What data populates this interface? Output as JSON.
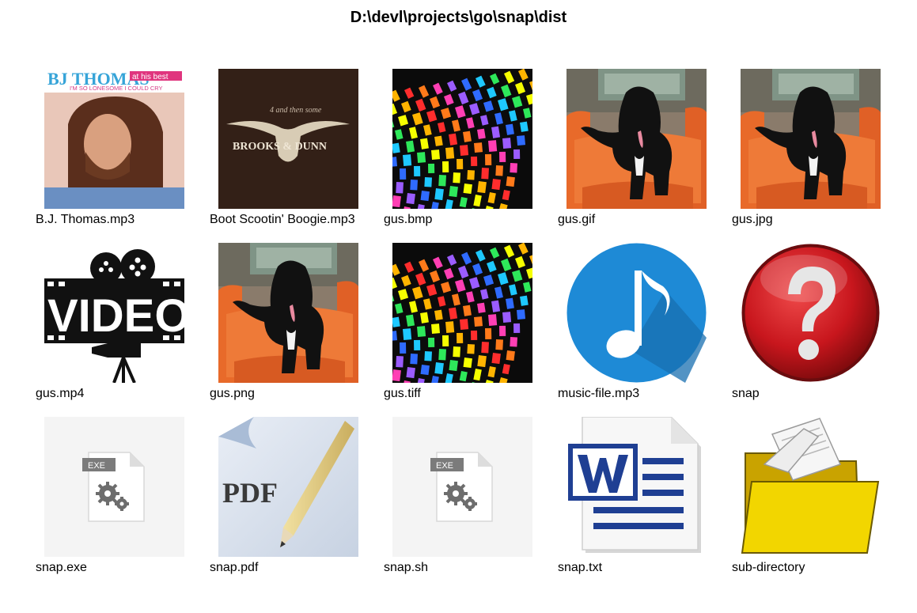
{
  "window": {
    "title": "D:\\devl\\projects\\go\\snap\\dist"
  },
  "colors": {
    "folder_yellow": "#f2d600",
    "word_blue": "#1f3f93",
    "music_blue": "#1e8ad6",
    "help_red": "#c8161d",
    "exe_gray": "#7b7b7b",
    "chair_orange": "#e86a2a"
  },
  "album_art": {
    "bj_name": "BJ THOMAS",
    "bj_badge": "at his best",
    "bj_subtitle": "I'M SO LONESOME I COULD CRY",
    "bd_text": "BROOKS & DUNN",
    "bd_script": "4 and then some",
    "video_text": "VIDEO",
    "pdf_text": "PDF",
    "exe_badge": "EXE"
  },
  "files": [
    {
      "name": "B.J. Thomas.mp3",
      "icon": "album-art-bj-thomas"
    },
    {
      "name": "Boot Scootin' Boogie.mp3",
      "icon": "album-art-brooks-dunn"
    },
    {
      "name": "gus.bmp",
      "icon": "mosaic-image"
    },
    {
      "name": "gus.gif",
      "icon": "dog-photo"
    },
    {
      "name": "gus.jpg",
      "icon": "dog-photo"
    },
    {
      "name": "gus.mp4",
      "icon": "video-camera-icon"
    },
    {
      "name": "gus.png",
      "icon": "dog-photo"
    },
    {
      "name": "gus.tiff",
      "icon": "mosaic-image"
    },
    {
      "name": "music-file.mp3",
      "icon": "music-note-icon"
    },
    {
      "name": "snap",
      "icon": "question-mark-icon"
    },
    {
      "name": "snap.exe",
      "icon": "exe-file-icon"
    },
    {
      "name": "snap.pdf",
      "icon": "pdf-file-icon"
    },
    {
      "name": "snap.sh",
      "icon": "exe-file-icon"
    },
    {
      "name": "snap.txt",
      "icon": "word-document-icon"
    },
    {
      "name": "sub-directory",
      "icon": "folder-icon"
    }
  ]
}
